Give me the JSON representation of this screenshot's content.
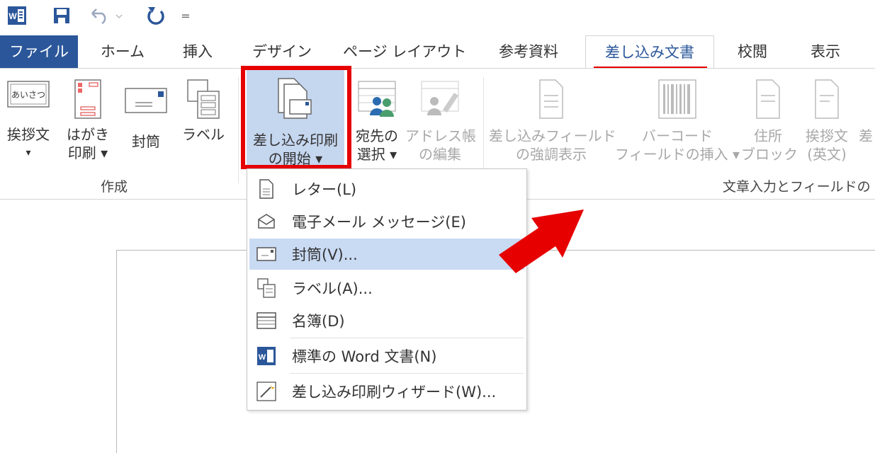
{
  "qat": {
    "logo_text": "W",
    "more": "="
  },
  "tabs": [
    {
      "label": "ファイル"
    },
    {
      "label": "ホーム"
    },
    {
      "label": "挿入"
    },
    {
      "label": "デザイン"
    },
    {
      "label": "ページ レイアウト"
    },
    {
      "label": "参考資料"
    },
    {
      "label": "差し込み文書"
    },
    {
      "label": "校閲"
    },
    {
      "label": "表示"
    }
  ],
  "ribbon": {
    "create": {
      "greeting": {
        "line1": "挨拶文",
        "line2": "▾",
        "icon_text": "あいさつ"
      },
      "postcard": {
        "line1": "はがき",
        "line2": "印刷 ▾"
      },
      "envelope": {
        "line1": "封筒"
      },
      "label": {
        "line1": "ラベル"
      },
      "group_label": "作成"
    },
    "start_mail_merge": {
      "line1": "差し込み印刷",
      "line2": "の開始 ▾"
    },
    "select_recipients": {
      "line1": "宛先の",
      "line2": "選択 ▾"
    },
    "edit_address": {
      "line1": "アドレス帳",
      "line2": "の編集"
    },
    "highlight_fields": {
      "line1": "差し込みフィールド",
      "line2": "の強調表示"
    },
    "barcode": {
      "line1": "バーコード",
      "line2": "フィールドの挿入 ▾"
    },
    "address_block": {
      "line1": "住所",
      "line2": "ブロック"
    },
    "greeting_en": {
      "line1": "挨拶文",
      "line2": "(英文)"
    },
    "cut_char": {
      "line1": "差"
    },
    "write_group_label": "文章入力とフィールドの"
  },
  "menu": {
    "items": [
      {
        "label": "レター(L)",
        "icon": "letter-icon"
      },
      {
        "label": "電子メール メッセージ(E)",
        "icon": "email-icon"
      },
      {
        "label": "封筒(V)...",
        "icon": "envelope-icon",
        "highlighted": true
      },
      {
        "label": "ラベル(A)...",
        "icon": "labels-icon"
      },
      {
        "label": "名簿(D)",
        "icon": "directory-icon"
      },
      {
        "label": "標準の Word 文書(N)",
        "icon": "word-doc-icon"
      },
      {
        "label": "差し込み印刷ウィザード(W)...",
        "icon": "wizard-icon"
      }
    ]
  },
  "colors": {
    "file_tab": "#2b579a",
    "highlight_red": "#e60000",
    "menu_hover": "#c9daf3",
    "button_pressed": "#c5d6ef"
  }
}
